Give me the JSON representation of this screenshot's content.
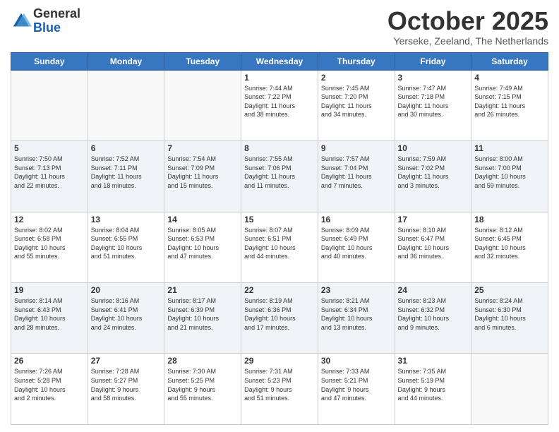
{
  "logo": {
    "general": "General",
    "blue": "Blue"
  },
  "header": {
    "month": "October 2025",
    "location": "Yerseke, Zeeland, The Netherlands"
  },
  "days_of_week": [
    "Sunday",
    "Monday",
    "Tuesday",
    "Wednesday",
    "Thursday",
    "Friday",
    "Saturday"
  ],
  "weeks": [
    [
      {
        "day": "",
        "info": ""
      },
      {
        "day": "",
        "info": ""
      },
      {
        "day": "",
        "info": ""
      },
      {
        "day": "1",
        "info": "Sunrise: 7:44 AM\nSunset: 7:22 PM\nDaylight: 11 hours\nand 38 minutes."
      },
      {
        "day": "2",
        "info": "Sunrise: 7:45 AM\nSunset: 7:20 PM\nDaylight: 11 hours\nand 34 minutes."
      },
      {
        "day": "3",
        "info": "Sunrise: 7:47 AM\nSunset: 7:18 PM\nDaylight: 11 hours\nand 30 minutes."
      },
      {
        "day": "4",
        "info": "Sunrise: 7:49 AM\nSunset: 7:15 PM\nDaylight: 11 hours\nand 26 minutes."
      }
    ],
    [
      {
        "day": "5",
        "info": "Sunrise: 7:50 AM\nSunset: 7:13 PM\nDaylight: 11 hours\nand 22 minutes."
      },
      {
        "day": "6",
        "info": "Sunrise: 7:52 AM\nSunset: 7:11 PM\nDaylight: 11 hours\nand 18 minutes."
      },
      {
        "day": "7",
        "info": "Sunrise: 7:54 AM\nSunset: 7:09 PM\nDaylight: 11 hours\nand 15 minutes."
      },
      {
        "day": "8",
        "info": "Sunrise: 7:55 AM\nSunset: 7:06 PM\nDaylight: 11 hours\nand 11 minutes."
      },
      {
        "day": "9",
        "info": "Sunrise: 7:57 AM\nSunset: 7:04 PM\nDaylight: 11 hours\nand 7 minutes."
      },
      {
        "day": "10",
        "info": "Sunrise: 7:59 AM\nSunset: 7:02 PM\nDaylight: 11 hours\nand 3 minutes."
      },
      {
        "day": "11",
        "info": "Sunrise: 8:00 AM\nSunset: 7:00 PM\nDaylight: 10 hours\nand 59 minutes."
      }
    ],
    [
      {
        "day": "12",
        "info": "Sunrise: 8:02 AM\nSunset: 6:58 PM\nDaylight: 10 hours\nand 55 minutes."
      },
      {
        "day": "13",
        "info": "Sunrise: 8:04 AM\nSunset: 6:55 PM\nDaylight: 10 hours\nand 51 minutes."
      },
      {
        "day": "14",
        "info": "Sunrise: 8:05 AM\nSunset: 6:53 PM\nDaylight: 10 hours\nand 47 minutes."
      },
      {
        "day": "15",
        "info": "Sunrise: 8:07 AM\nSunset: 6:51 PM\nDaylight: 10 hours\nand 44 minutes."
      },
      {
        "day": "16",
        "info": "Sunrise: 8:09 AM\nSunset: 6:49 PM\nDaylight: 10 hours\nand 40 minutes."
      },
      {
        "day": "17",
        "info": "Sunrise: 8:10 AM\nSunset: 6:47 PM\nDaylight: 10 hours\nand 36 minutes."
      },
      {
        "day": "18",
        "info": "Sunrise: 8:12 AM\nSunset: 6:45 PM\nDaylight: 10 hours\nand 32 minutes."
      }
    ],
    [
      {
        "day": "19",
        "info": "Sunrise: 8:14 AM\nSunset: 6:43 PM\nDaylight: 10 hours\nand 28 minutes."
      },
      {
        "day": "20",
        "info": "Sunrise: 8:16 AM\nSunset: 6:41 PM\nDaylight: 10 hours\nand 24 minutes."
      },
      {
        "day": "21",
        "info": "Sunrise: 8:17 AM\nSunset: 6:39 PM\nDaylight: 10 hours\nand 21 minutes."
      },
      {
        "day": "22",
        "info": "Sunrise: 8:19 AM\nSunset: 6:36 PM\nDaylight: 10 hours\nand 17 minutes."
      },
      {
        "day": "23",
        "info": "Sunrise: 8:21 AM\nSunset: 6:34 PM\nDaylight: 10 hours\nand 13 minutes."
      },
      {
        "day": "24",
        "info": "Sunrise: 8:23 AM\nSunset: 6:32 PM\nDaylight: 10 hours\nand 9 minutes."
      },
      {
        "day": "25",
        "info": "Sunrise: 8:24 AM\nSunset: 6:30 PM\nDaylight: 10 hours\nand 6 minutes."
      }
    ],
    [
      {
        "day": "26",
        "info": "Sunrise: 7:26 AM\nSunset: 5:28 PM\nDaylight: 10 hours\nand 2 minutes."
      },
      {
        "day": "27",
        "info": "Sunrise: 7:28 AM\nSunset: 5:27 PM\nDaylight: 9 hours\nand 58 minutes."
      },
      {
        "day": "28",
        "info": "Sunrise: 7:30 AM\nSunset: 5:25 PM\nDaylight: 9 hours\nand 55 minutes."
      },
      {
        "day": "29",
        "info": "Sunrise: 7:31 AM\nSunset: 5:23 PM\nDaylight: 9 hours\nand 51 minutes."
      },
      {
        "day": "30",
        "info": "Sunrise: 7:33 AM\nSunset: 5:21 PM\nDaylight: 9 hours\nand 47 minutes."
      },
      {
        "day": "31",
        "info": "Sunrise: 7:35 AM\nSunset: 5:19 PM\nDaylight: 9 hours\nand 44 minutes."
      },
      {
        "day": "",
        "info": ""
      }
    ]
  ]
}
